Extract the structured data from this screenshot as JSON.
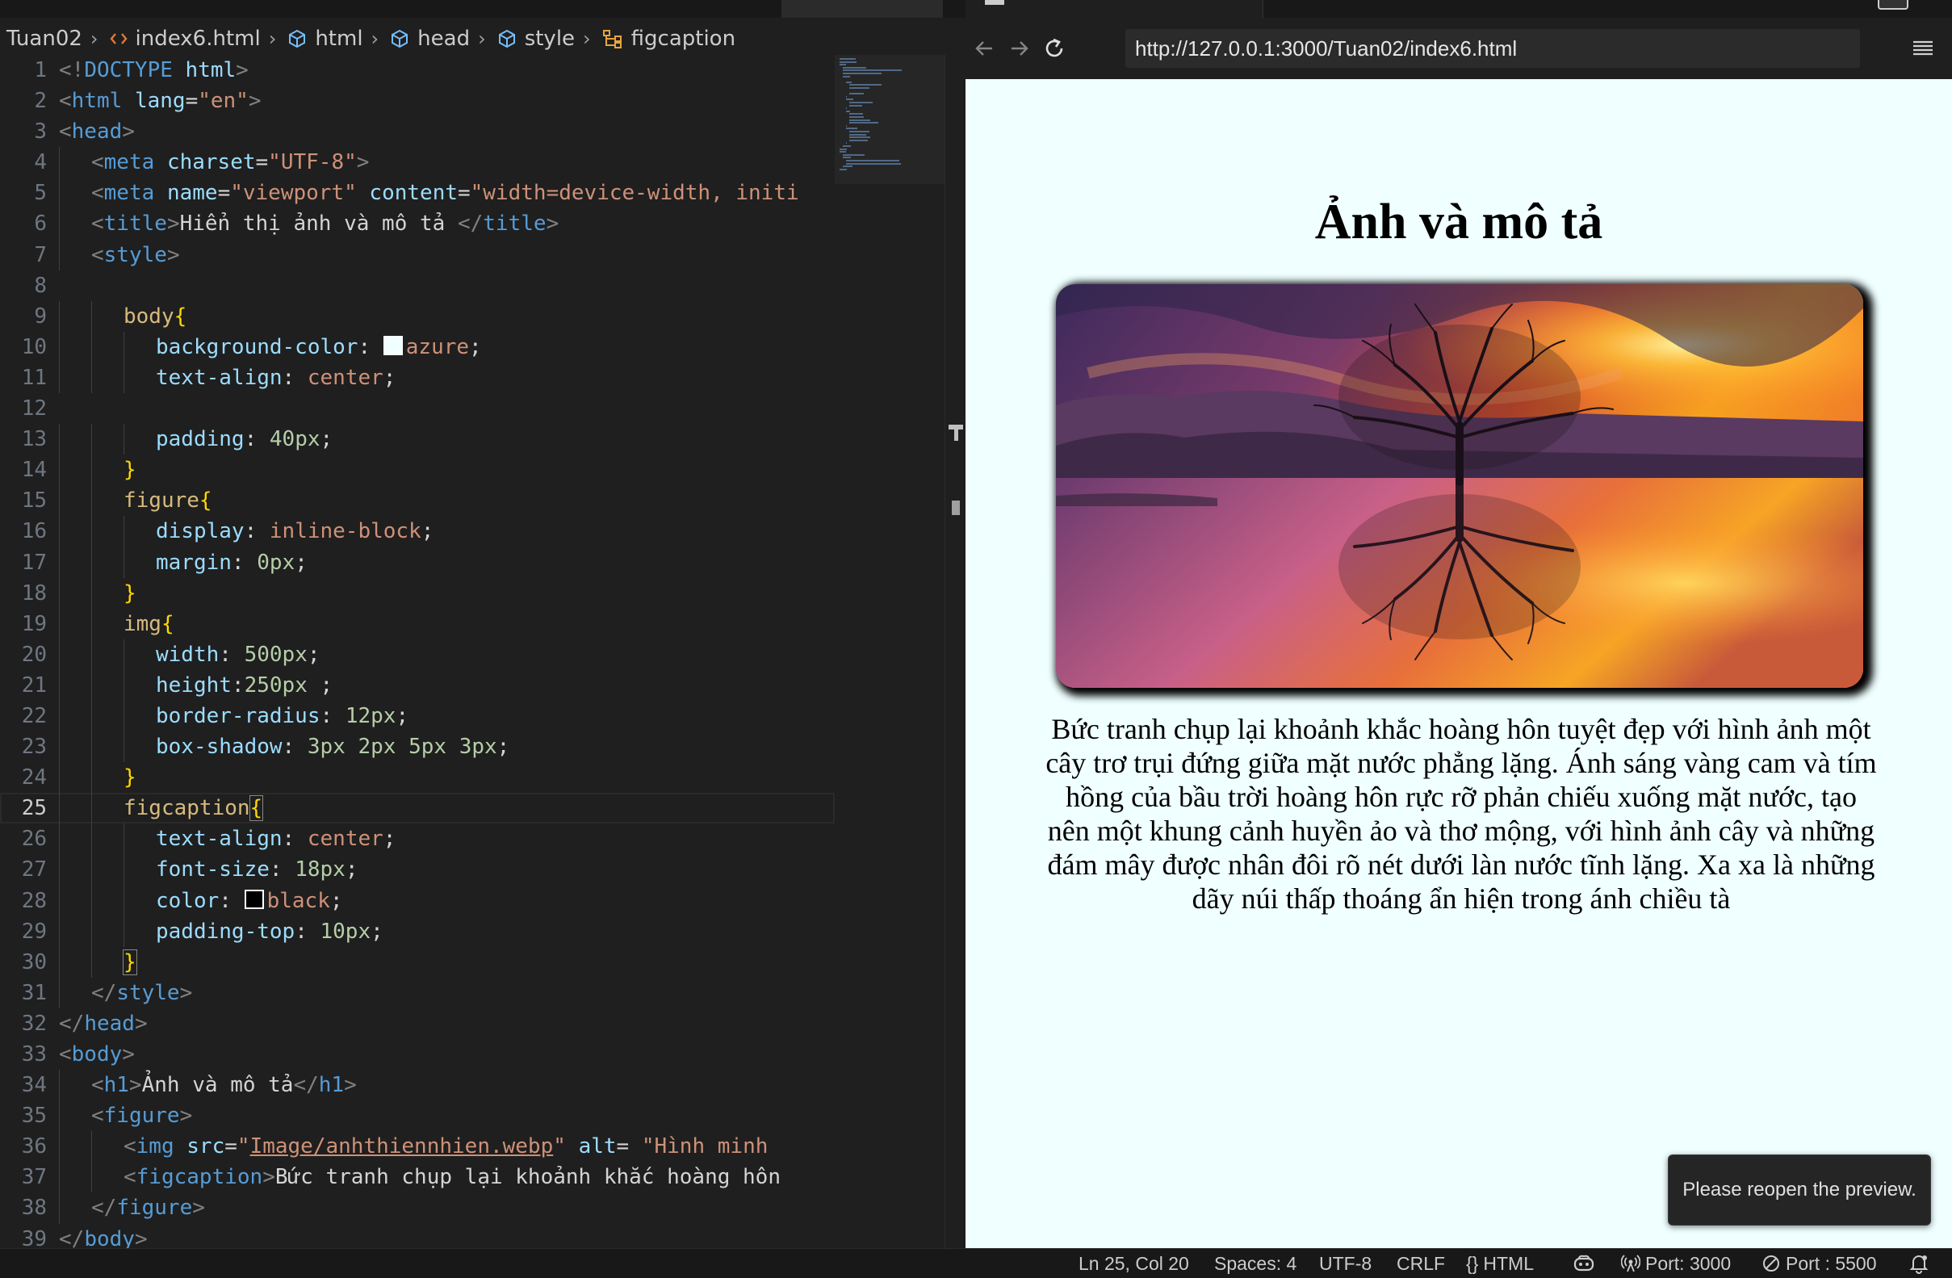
{
  "breadcrumb": {
    "folder": "Tuan02",
    "file": "index6.html",
    "path": [
      "html",
      "head",
      "style",
      "figcaption"
    ]
  },
  "editor": {
    "current_line": 25,
    "lines": [
      {
        "n": 1,
        "indent": 0,
        "tokens": [
          [
            "br",
            "<!"
          ],
          [
            "tag",
            "DOCTYPE"
          ],
          [
            "txt",
            " "
          ],
          [
            "attr",
            "html"
          ],
          [
            "br",
            ">"
          ]
        ]
      },
      {
        "n": 2,
        "indent": 0,
        "tokens": [
          [
            "br",
            "<"
          ],
          [
            "tag",
            "html"
          ],
          [
            "txt",
            " "
          ],
          [
            "attr",
            "lang"
          ],
          [
            "txt",
            "="
          ],
          [
            "str",
            "\"en\""
          ],
          [
            "br",
            ">"
          ]
        ]
      },
      {
        "n": 3,
        "indent": 0,
        "tokens": [
          [
            "br",
            "<"
          ],
          [
            "tag",
            "head"
          ],
          [
            "br",
            ">"
          ]
        ]
      },
      {
        "n": 4,
        "indent": 1,
        "tokens": [
          [
            "br",
            "<"
          ],
          [
            "tag",
            "meta"
          ],
          [
            "txt",
            " "
          ],
          [
            "attr",
            "charset"
          ],
          [
            "txt",
            "="
          ],
          [
            "str",
            "\"UTF-8\""
          ],
          [
            "br",
            ">"
          ]
        ]
      },
      {
        "n": 5,
        "indent": 1,
        "tokens": [
          [
            "br",
            "<"
          ],
          [
            "tag",
            "meta"
          ],
          [
            "txt",
            " "
          ],
          [
            "attr",
            "name"
          ],
          [
            "txt",
            "="
          ],
          [
            "str",
            "\"viewport\""
          ],
          [
            "txt",
            " "
          ],
          [
            "attr",
            "content"
          ],
          [
            "txt",
            "="
          ],
          [
            "str",
            "\"width=device-width, initi"
          ]
        ]
      },
      {
        "n": 6,
        "indent": 1,
        "tokens": [
          [
            "br",
            "<"
          ],
          [
            "tag",
            "title"
          ],
          [
            "br",
            ">"
          ],
          [
            "txt",
            "Hiển thị ảnh và mô tả "
          ],
          [
            "br",
            "</"
          ],
          [
            "tag",
            "title"
          ],
          [
            "br",
            ">"
          ]
        ]
      },
      {
        "n": 7,
        "indent": 1,
        "tokens": [
          [
            "br",
            "<"
          ],
          [
            "tag",
            "style"
          ],
          [
            "br",
            ">"
          ]
        ]
      },
      {
        "n": 8,
        "indent": 0,
        "tokens": []
      },
      {
        "n": 9,
        "indent": 2,
        "tokens": [
          [
            "sel",
            "body"
          ],
          [
            "brace",
            "{"
          ]
        ]
      },
      {
        "n": 10,
        "indent": 3,
        "tokens": [
          [
            "prop",
            "background-color"
          ],
          [
            "txt",
            ": "
          ],
          [
            "swatch",
            "#f0ffff"
          ],
          [
            "val",
            "azure"
          ],
          [
            "txt",
            ";"
          ]
        ]
      },
      {
        "n": 11,
        "indent": 3,
        "tokens": [
          [
            "prop",
            "text-align"
          ],
          [
            "txt",
            ": "
          ],
          [
            "val",
            "center"
          ],
          [
            "txt",
            ";"
          ]
        ]
      },
      {
        "n": 12,
        "indent": 0,
        "tokens": []
      },
      {
        "n": 13,
        "indent": 3,
        "tokens": [
          [
            "prop",
            "padding"
          ],
          [
            "txt",
            ": "
          ],
          [
            "num",
            "40px"
          ],
          [
            "txt",
            ";"
          ]
        ]
      },
      {
        "n": 14,
        "indent": 2,
        "tokens": [
          [
            "brace",
            "}"
          ]
        ]
      },
      {
        "n": 15,
        "indent": 2,
        "tokens": [
          [
            "sel",
            "figure"
          ],
          [
            "brace",
            "{"
          ]
        ]
      },
      {
        "n": 16,
        "indent": 3,
        "tokens": [
          [
            "prop",
            "display"
          ],
          [
            "txt",
            ": "
          ],
          [
            "val",
            "inline-block"
          ],
          [
            "txt",
            ";"
          ]
        ]
      },
      {
        "n": 17,
        "indent": 3,
        "tokens": [
          [
            "prop",
            "margin"
          ],
          [
            "txt",
            ": "
          ],
          [
            "num",
            "0px"
          ],
          [
            "txt",
            ";"
          ]
        ]
      },
      {
        "n": 18,
        "indent": 2,
        "tokens": [
          [
            "brace",
            "}"
          ]
        ]
      },
      {
        "n": 19,
        "indent": 2,
        "tokens": [
          [
            "sel",
            "img"
          ],
          [
            "brace",
            "{"
          ]
        ]
      },
      {
        "n": 20,
        "indent": 3,
        "tokens": [
          [
            "prop",
            "width"
          ],
          [
            "txt",
            ": "
          ],
          [
            "num",
            "500px"
          ],
          [
            "txt",
            ";"
          ]
        ]
      },
      {
        "n": 21,
        "indent": 3,
        "tokens": [
          [
            "prop",
            "height"
          ],
          [
            "txt",
            ":"
          ],
          [
            "num",
            "250px"
          ],
          [
            "txt",
            " ;"
          ]
        ]
      },
      {
        "n": 22,
        "indent": 3,
        "tokens": [
          [
            "prop",
            "border-radius"
          ],
          [
            "txt",
            ": "
          ],
          [
            "num",
            "12px"
          ],
          [
            "txt",
            ";"
          ]
        ]
      },
      {
        "n": 23,
        "indent": 3,
        "tokens": [
          [
            "prop",
            "box-shadow"
          ],
          [
            "txt",
            ": "
          ],
          [
            "num",
            "3px 2px 5px 3px"
          ],
          [
            "txt",
            ";"
          ]
        ]
      },
      {
        "n": 24,
        "indent": 2,
        "tokens": [
          [
            "brace",
            "}"
          ]
        ]
      },
      {
        "n": 25,
        "indent": 2,
        "tokens": [
          [
            "sel",
            "figcaption"
          ],
          [
            "bm",
            "{"
          ]
        ]
      },
      {
        "n": 26,
        "indent": 3,
        "tokens": [
          [
            "prop",
            "text-align"
          ],
          [
            "txt",
            ": "
          ],
          [
            "val",
            "center"
          ],
          [
            "txt",
            ";"
          ]
        ]
      },
      {
        "n": 27,
        "indent": 3,
        "tokens": [
          [
            "prop",
            "font-size"
          ],
          [
            "txt",
            ": "
          ],
          [
            "num",
            "18px"
          ],
          [
            "txt",
            ";"
          ]
        ]
      },
      {
        "n": 28,
        "indent": 3,
        "tokens": [
          [
            "prop",
            "color"
          ],
          [
            "txt",
            ": "
          ],
          [
            "swatch",
            "#000000"
          ],
          [
            "val",
            "black"
          ],
          [
            "txt",
            ";"
          ]
        ]
      },
      {
        "n": 29,
        "indent": 3,
        "tokens": [
          [
            "prop",
            "padding-top"
          ],
          [
            "txt",
            ": "
          ],
          [
            "num",
            "10px"
          ],
          [
            "txt",
            ";"
          ]
        ]
      },
      {
        "n": 30,
        "indent": 2,
        "tokens": [
          [
            "bm",
            "}"
          ]
        ]
      },
      {
        "n": 31,
        "indent": 1,
        "tokens": [
          [
            "br",
            "</"
          ],
          [
            "tag",
            "style"
          ],
          [
            "br",
            ">"
          ]
        ]
      },
      {
        "n": 32,
        "indent": 0,
        "tokens": [
          [
            "br",
            "</"
          ],
          [
            "tag",
            "head"
          ],
          [
            "br",
            ">"
          ]
        ]
      },
      {
        "n": 33,
        "indent": 0,
        "tokens": [
          [
            "br",
            "<"
          ],
          [
            "tag",
            "body"
          ],
          [
            "br",
            ">"
          ]
        ]
      },
      {
        "n": 34,
        "indent": 1,
        "tokens": [
          [
            "br",
            "<"
          ],
          [
            "tag",
            "h1"
          ],
          [
            "br",
            ">"
          ],
          [
            "txt",
            "Ảnh và mô tả"
          ],
          [
            "br",
            "</"
          ],
          [
            "tag",
            "h1"
          ],
          [
            "br",
            ">"
          ]
        ]
      },
      {
        "n": 35,
        "indent": 1,
        "tokens": [
          [
            "br",
            "<"
          ],
          [
            "tag",
            "figure"
          ],
          [
            "br",
            ">"
          ]
        ]
      },
      {
        "n": 36,
        "indent": 2,
        "tokens": [
          [
            "br",
            "<"
          ],
          [
            "tag",
            "img"
          ],
          [
            "txt",
            " "
          ],
          [
            "attr",
            "src"
          ],
          [
            "txt",
            "="
          ],
          [
            "str",
            "\""
          ],
          [
            "link",
            "Image/anhthiennhien.webp"
          ],
          [
            "str",
            "\""
          ],
          [
            "txt",
            " "
          ],
          [
            "attr",
            "alt"
          ],
          [
            "txt",
            "= "
          ],
          [
            "str",
            "\"Hình minh"
          ]
        ]
      },
      {
        "n": 37,
        "indent": 2,
        "tokens": [
          [
            "br",
            "<"
          ],
          [
            "tag",
            "figcaption"
          ],
          [
            "br",
            ">"
          ],
          [
            "txt",
            "Bức tranh chụp lại khoảnh khắc hoàng hôn"
          ]
        ]
      },
      {
        "n": 38,
        "indent": 1,
        "tokens": [
          [
            "br",
            "</"
          ],
          [
            "tag",
            "figure"
          ],
          [
            "br",
            ">"
          ]
        ]
      },
      {
        "n": 39,
        "indent": 0,
        "tokens": [
          [
            "br",
            "</"
          ],
          [
            "tag",
            "body"
          ],
          [
            "br",
            ">"
          ]
        ]
      }
    ]
  },
  "browser": {
    "url": "http://127.0.0.1:3000/Tuan02/index6.html",
    "page": {
      "heading": "Ảnh và mô tả",
      "image_alt": "Hình minh",
      "caption": "Bức tranh chụp lại khoảnh khắc hoàng hôn tuyệt đẹp với hình ảnh một cây trơ trụi đứng giữa mặt nước phẳng lặng. Ánh sáng vàng cam và tím hồng của bầu trời hoàng hôn rực rỡ phản chiếu xuống mặt nước, tạo nên một khung cảnh huyền ảo và thơ mộng, với hình ảnh cây và những đám mây được nhân đôi rõ nét dưới làn nước tĩnh lặng. Xa xa là những dãy núi thấp thoáng ẩn hiện trong ánh chiều tà"
    },
    "toast": "Please reopen the preview."
  },
  "status_bar": {
    "position": "Ln 25, Col 20",
    "spaces": "Spaces: 4",
    "encoding": "UTF-8",
    "eol": "CRLF",
    "language": "HTML",
    "port1": "Port: 3000",
    "port2": "Port : 5500"
  },
  "colors": {
    "editor_bg": "#1f1f1f",
    "page_bg": "#f0ffff",
    "tag": "#569cd6",
    "attr": "#9cdcfe",
    "string": "#ce9178",
    "selector": "#d7ba7d",
    "number": "#b5cea8"
  }
}
